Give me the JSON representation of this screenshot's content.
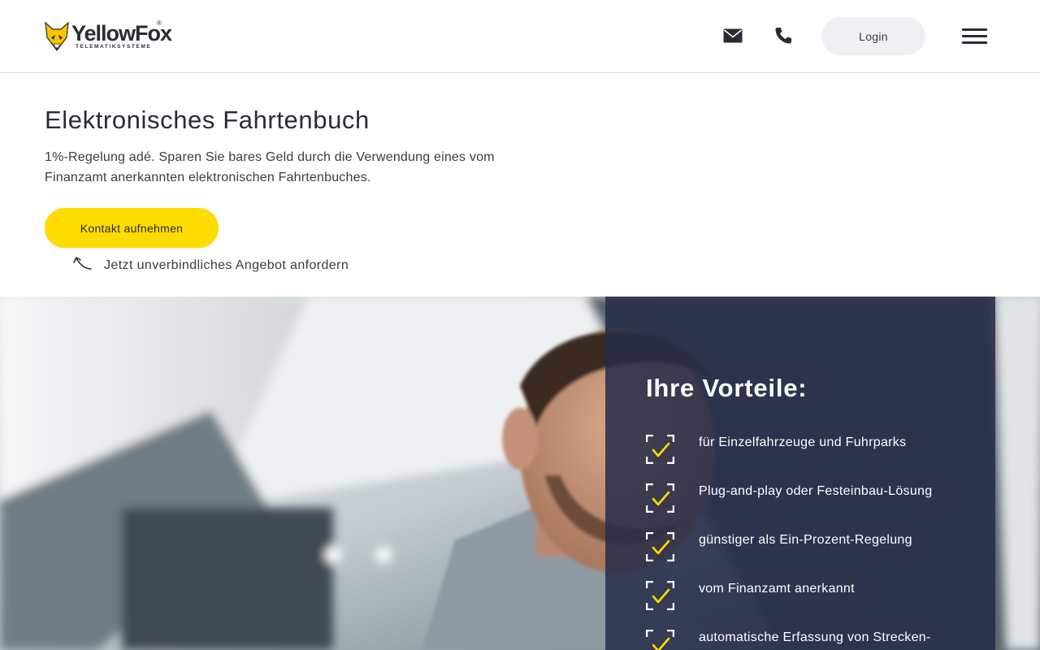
{
  "header": {
    "logo": {
      "brand": "YellowFox",
      "registered": "®",
      "tagline": "TELEMATIKSYSTEME"
    },
    "login_label": "Login",
    "icons": [
      "mail-icon",
      "phone-icon",
      "menu-icon"
    ]
  },
  "intro": {
    "title": "Elektronisches Fahrtenbuch",
    "text": "1%-Regelung adé. Sparen Sie bares Geld durch die Verwendung eines vom Finanzamt anerkannten elektronischen Fahrtenbuches.",
    "cta_label": "Kontakt aufnehmen",
    "cta_hint": "Jetzt unverbindliches Angebot anfordern"
  },
  "benefits": {
    "title": "Ihre Vorteile:",
    "items": [
      "für Einzelfahrzeuge und Fuhrparks",
      "Plug-and-play oder Festeinbau-Lösung",
      "günstiger als Ein-Prozent-Regelung",
      "vom Finanzamt anerkannt",
      "automatische Erfassung von Strecken-"
    ]
  },
  "colors": {
    "accent": "#ffdc00",
    "text": "#2b2b35",
    "panel": "#262c48",
    "login_bg": "#eef1f3"
  }
}
